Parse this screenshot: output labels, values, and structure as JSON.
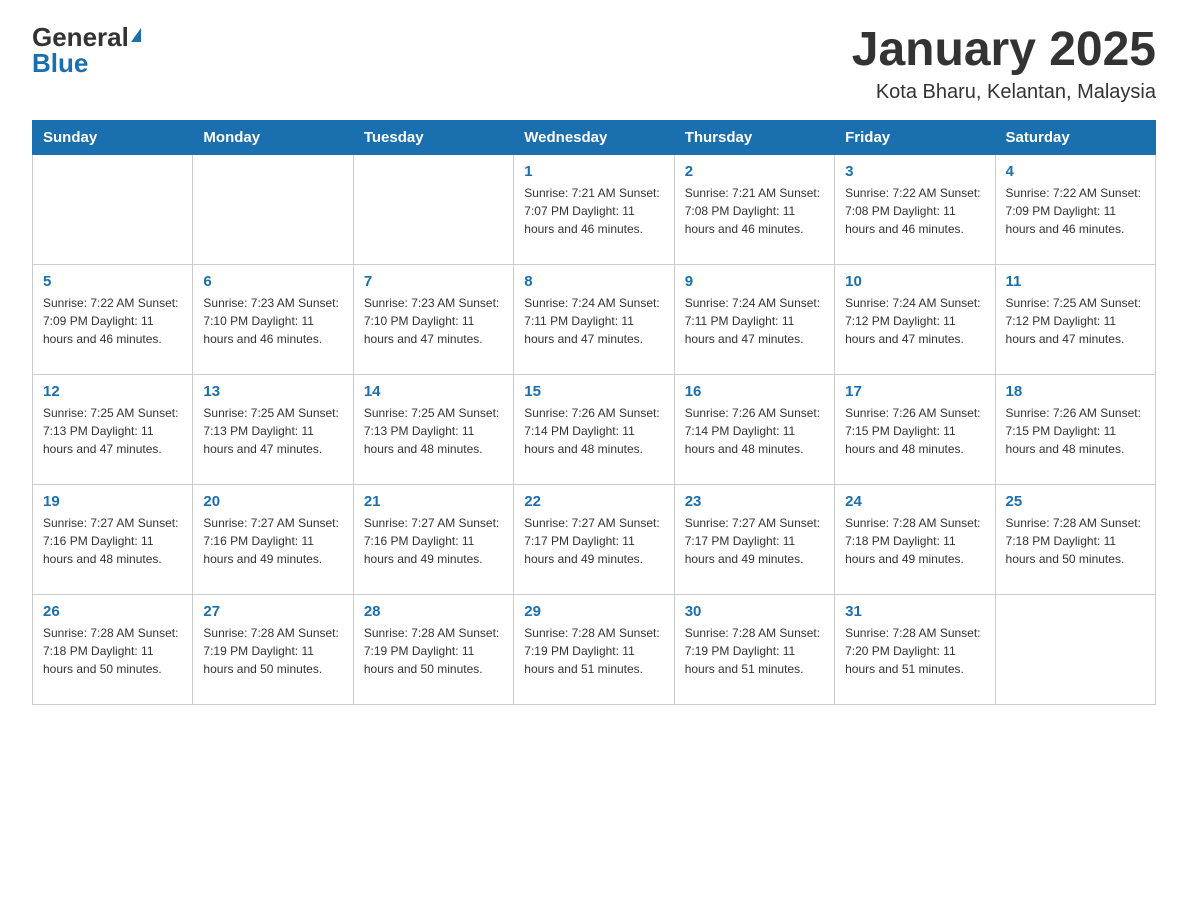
{
  "header": {
    "logo_general": "General",
    "logo_blue": "Blue",
    "month_title": "January 2025",
    "location": "Kota Bharu, Kelantan, Malaysia"
  },
  "days_of_week": [
    "Sunday",
    "Monday",
    "Tuesday",
    "Wednesday",
    "Thursday",
    "Friday",
    "Saturday"
  ],
  "weeks": [
    [
      {
        "day": "",
        "info": ""
      },
      {
        "day": "",
        "info": ""
      },
      {
        "day": "",
        "info": ""
      },
      {
        "day": "1",
        "info": "Sunrise: 7:21 AM\nSunset: 7:07 PM\nDaylight: 11 hours\nand 46 minutes."
      },
      {
        "day": "2",
        "info": "Sunrise: 7:21 AM\nSunset: 7:08 PM\nDaylight: 11 hours\nand 46 minutes."
      },
      {
        "day": "3",
        "info": "Sunrise: 7:22 AM\nSunset: 7:08 PM\nDaylight: 11 hours\nand 46 minutes."
      },
      {
        "day": "4",
        "info": "Sunrise: 7:22 AM\nSunset: 7:09 PM\nDaylight: 11 hours\nand 46 minutes."
      }
    ],
    [
      {
        "day": "5",
        "info": "Sunrise: 7:22 AM\nSunset: 7:09 PM\nDaylight: 11 hours\nand 46 minutes."
      },
      {
        "day": "6",
        "info": "Sunrise: 7:23 AM\nSunset: 7:10 PM\nDaylight: 11 hours\nand 46 minutes."
      },
      {
        "day": "7",
        "info": "Sunrise: 7:23 AM\nSunset: 7:10 PM\nDaylight: 11 hours\nand 47 minutes."
      },
      {
        "day": "8",
        "info": "Sunrise: 7:24 AM\nSunset: 7:11 PM\nDaylight: 11 hours\nand 47 minutes."
      },
      {
        "day": "9",
        "info": "Sunrise: 7:24 AM\nSunset: 7:11 PM\nDaylight: 11 hours\nand 47 minutes."
      },
      {
        "day": "10",
        "info": "Sunrise: 7:24 AM\nSunset: 7:12 PM\nDaylight: 11 hours\nand 47 minutes."
      },
      {
        "day": "11",
        "info": "Sunrise: 7:25 AM\nSunset: 7:12 PM\nDaylight: 11 hours\nand 47 minutes."
      }
    ],
    [
      {
        "day": "12",
        "info": "Sunrise: 7:25 AM\nSunset: 7:13 PM\nDaylight: 11 hours\nand 47 minutes."
      },
      {
        "day": "13",
        "info": "Sunrise: 7:25 AM\nSunset: 7:13 PM\nDaylight: 11 hours\nand 47 minutes."
      },
      {
        "day": "14",
        "info": "Sunrise: 7:25 AM\nSunset: 7:13 PM\nDaylight: 11 hours\nand 48 minutes."
      },
      {
        "day": "15",
        "info": "Sunrise: 7:26 AM\nSunset: 7:14 PM\nDaylight: 11 hours\nand 48 minutes."
      },
      {
        "day": "16",
        "info": "Sunrise: 7:26 AM\nSunset: 7:14 PM\nDaylight: 11 hours\nand 48 minutes."
      },
      {
        "day": "17",
        "info": "Sunrise: 7:26 AM\nSunset: 7:15 PM\nDaylight: 11 hours\nand 48 minutes."
      },
      {
        "day": "18",
        "info": "Sunrise: 7:26 AM\nSunset: 7:15 PM\nDaylight: 11 hours\nand 48 minutes."
      }
    ],
    [
      {
        "day": "19",
        "info": "Sunrise: 7:27 AM\nSunset: 7:16 PM\nDaylight: 11 hours\nand 48 minutes."
      },
      {
        "day": "20",
        "info": "Sunrise: 7:27 AM\nSunset: 7:16 PM\nDaylight: 11 hours\nand 49 minutes."
      },
      {
        "day": "21",
        "info": "Sunrise: 7:27 AM\nSunset: 7:16 PM\nDaylight: 11 hours\nand 49 minutes."
      },
      {
        "day": "22",
        "info": "Sunrise: 7:27 AM\nSunset: 7:17 PM\nDaylight: 11 hours\nand 49 minutes."
      },
      {
        "day": "23",
        "info": "Sunrise: 7:27 AM\nSunset: 7:17 PM\nDaylight: 11 hours\nand 49 minutes."
      },
      {
        "day": "24",
        "info": "Sunrise: 7:28 AM\nSunset: 7:18 PM\nDaylight: 11 hours\nand 49 minutes."
      },
      {
        "day": "25",
        "info": "Sunrise: 7:28 AM\nSunset: 7:18 PM\nDaylight: 11 hours\nand 50 minutes."
      }
    ],
    [
      {
        "day": "26",
        "info": "Sunrise: 7:28 AM\nSunset: 7:18 PM\nDaylight: 11 hours\nand 50 minutes."
      },
      {
        "day": "27",
        "info": "Sunrise: 7:28 AM\nSunset: 7:19 PM\nDaylight: 11 hours\nand 50 minutes."
      },
      {
        "day": "28",
        "info": "Sunrise: 7:28 AM\nSunset: 7:19 PM\nDaylight: 11 hours\nand 50 minutes."
      },
      {
        "day": "29",
        "info": "Sunrise: 7:28 AM\nSunset: 7:19 PM\nDaylight: 11 hours\nand 51 minutes."
      },
      {
        "day": "30",
        "info": "Sunrise: 7:28 AM\nSunset: 7:19 PM\nDaylight: 11 hours\nand 51 minutes."
      },
      {
        "day": "31",
        "info": "Sunrise: 7:28 AM\nSunset: 7:20 PM\nDaylight: 11 hours\nand 51 minutes."
      },
      {
        "day": "",
        "info": ""
      }
    ]
  ]
}
